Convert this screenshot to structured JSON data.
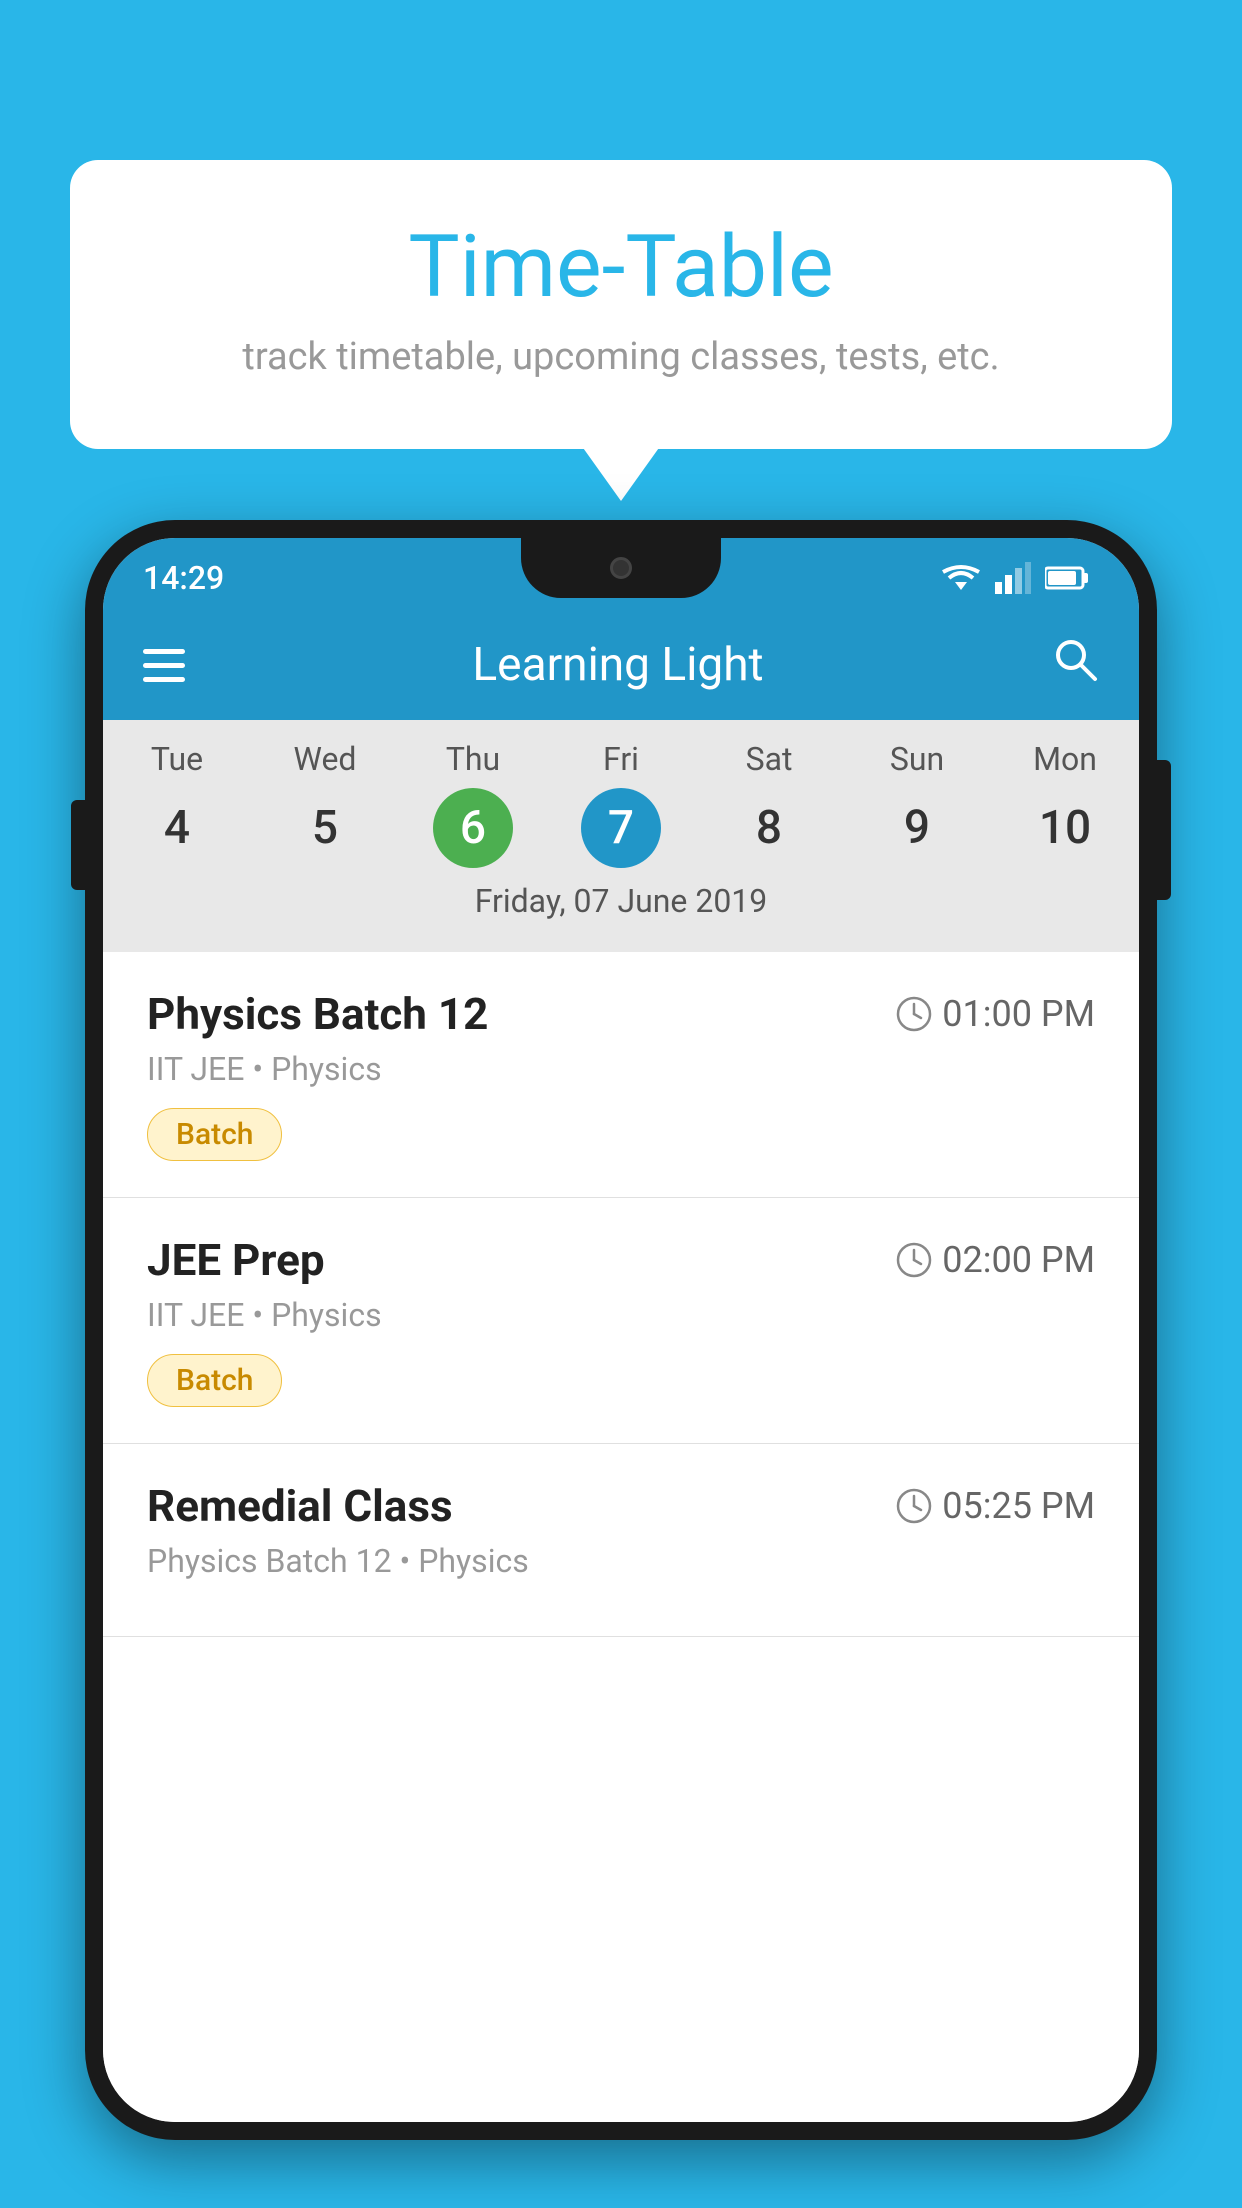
{
  "background_color": "#29b6e8",
  "bubble": {
    "title": "Time-Table",
    "subtitle": "track timetable, upcoming classes, tests, etc."
  },
  "status_bar": {
    "time": "14:29"
  },
  "app_bar": {
    "title": "Learning Light"
  },
  "calendar": {
    "day_names": [
      "Tue",
      "Wed",
      "Thu",
      "Fri",
      "Sat",
      "Sun",
      "Mon"
    ],
    "day_numbers": [
      "4",
      "5",
      "6",
      "7",
      "8",
      "9",
      "10"
    ],
    "today_index": 2,
    "selected_index": 3,
    "selected_date_label": "Friday, 07 June 2019"
  },
  "classes": [
    {
      "name": "Physics Batch 12",
      "time": "01:00 PM",
      "meta": "IIT JEE • Physics",
      "badge": "Batch"
    },
    {
      "name": "JEE Prep",
      "time": "02:00 PM",
      "meta": "IIT JEE • Physics",
      "badge": "Batch"
    },
    {
      "name": "Remedial Class",
      "time": "05:25 PM",
      "meta": "Physics Batch 12 • Physics",
      "badge": ""
    }
  ],
  "icons": {
    "menu": "☰",
    "search": "🔍",
    "clock": "🕐"
  }
}
